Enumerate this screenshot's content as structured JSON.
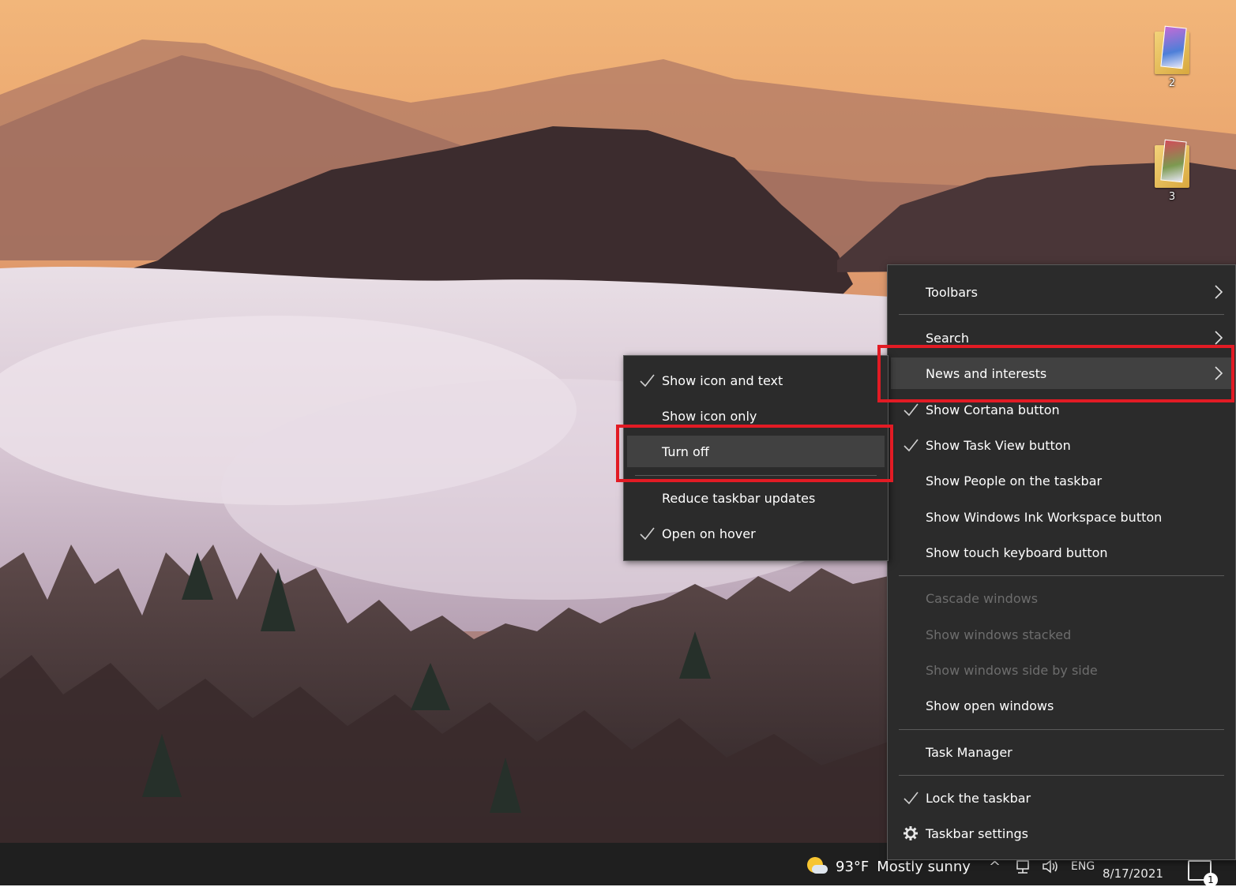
{
  "desktop_icons": [
    {
      "label": "2",
      "icon": "folder-icon"
    },
    {
      "label": "3",
      "icon": "folder-icon"
    }
  ],
  "taskbar_menu": {
    "items": [
      {
        "label": "Toolbars",
        "submenu": true,
        "checked": false,
        "disabled": false
      },
      {
        "label": "Search",
        "submenu": true,
        "checked": false,
        "disabled": false
      },
      {
        "label": "News and interests",
        "submenu": true,
        "checked": false,
        "disabled": false,
        "highlighted": true
      },
      {
        "label": "Show Cortana button",
        "checked": true,
        "disabled": false
      },
      {
        "label": "Show Task View button",
        "checked": true,
        "disabled": false
      },
      {
        "label": "Show People on the taskbar",
        "checked": false,
        "disabled": false
      },
      {
        "label": "Show Windows Ink Workspace button",
        "checked": false,
        "disabled": false
      },
      {
        "label": "Show touch keyboard button",
        "checked": false,
        "disabled": false
      },
      {
        "label": "Cascade windows",
        "checked": false,
        "disabled": true
      },
      {
        "label": "Show windows stacked",
        "checked": false,
        "disabled": true
      },
      {
        "label": "Show windows side by side",
        "checked": false,
        "disabled": true
      },
      {
        "label": "Show open windows",
        "checked": false,
        "disabled": false
      },
      {
        "label": "Task Manager",
        "checked": false,
        "disabled": false
      },
      {
        "label": "Lock the taskbar",
        "checked": true,
        "disabled": false
      },
      {
        "label": "Taskbar settings",
        "icon": "gear-icon",
        "disabled": false
      }
    ]
  },
  "news_submenu": {
    "items": [
      {
        "label": "Show icon and text",
        "checked": true
      },
      {
        "label": "Show icon only",
        "checked": false
      },
      {
        "label": "Turn off",
        "checked": false,
        "highlighted": true
      },
      {
        "label": "Reduce taskbar updates",
        "checked": false
      },
      {
        "label": "Open on hover",
        "checked": true
      }
    ]
  },
  "taskbar": {
    "weather_temp": "93°F",
    "weather_text": "Mostly sunny",
    "weather_icon": "partly-sunny-icon",
    "tray_language": "ENG",
    "date": "8/17/2021",
    "notification_count": "1"
  },
  "colors": {
    "menu_bg": "#2b2b2b",
    "highlight_border": "#e21b24",
    "disabled_text": "#6d6d6d"
  }
}
